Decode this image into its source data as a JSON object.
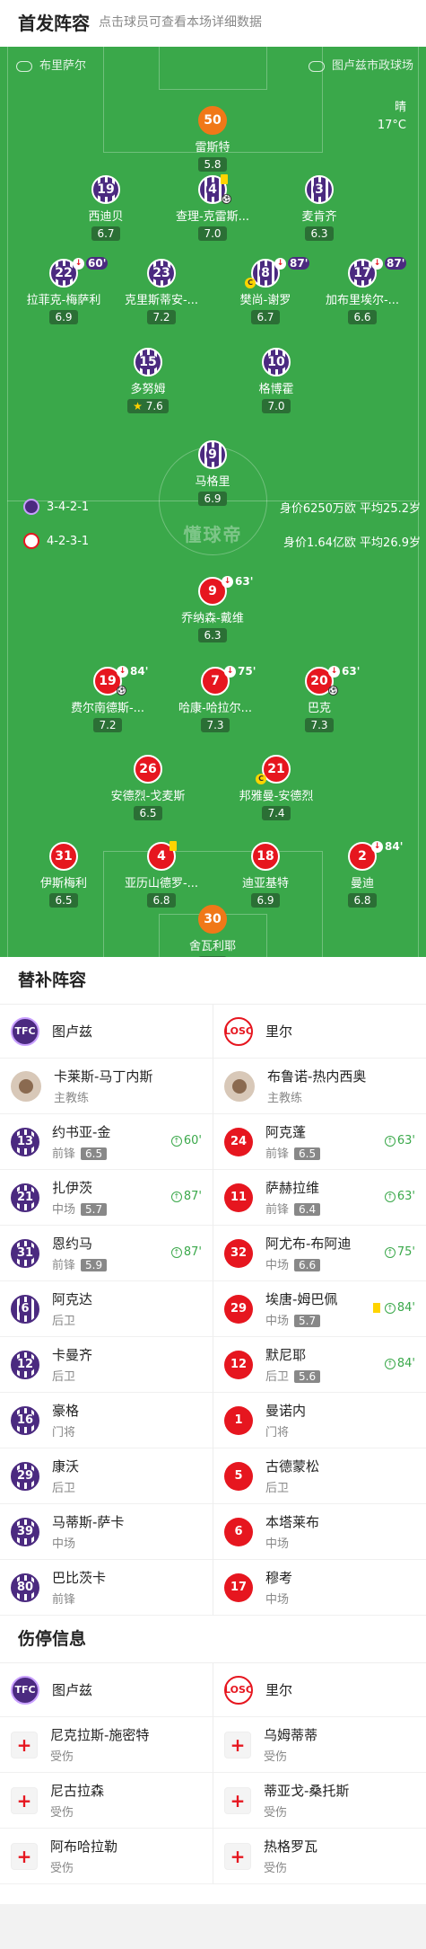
{
  "header": {
    "title": "首发阵容",
    "hint": "点击球员可查看本场详细数据"
  },
  "pitch": {
    "home_team": "布里萨尔",
    "away_team": "图卢兹市政球场",
    "weather": "晴",
    "temperature": "17°C",
    "center_watermark": "懂球帝",
    "tou_formation": "3-4-2-1",
    "tou_value": "身价6250万欧  平均25.2岁",
    "lil_formation": "4-2-3-1",
    "lil_value": "身价1.64亿欧  平均26.9岁"
  },
  "tou_players": [
    {
      "num": "50",
      "name": "雷斯特",
      "rating": "5.8",
      "gk": true
    },
    {
      "num": "19",
      "name": "西迪贝",
      "rating": "6.7"
    },
    {
      "num": "4",
      "name": "查理-克雷斯...",
      "rating": "7.0",
      "yellow": true,
      "goal": true
    },
    {
      "num": "3",
      "name": "麦肯齐",
      "rating": "6.3"
    },
    {
      "num": "22",
      "name": "拉菲克-梅萨利",
      "rating": "6.9",
      "sub": "60'"
    },
    {
      "num": "23",
      "name": "克里斯蒂安-...",
      "rating": "7.2"
    },
    {
      "num": "8",
      "name": "樊尚-谢罗",
      "rating": "6.7",
      "sub": "87'",
      "cap": true
    },
    {
      "num": "17",
      "name": "加布里埃尔-...",
      "rating": "6.6",
      "sub": "87'"
    },
    {
      "num": "15",
      "name": "多努姆",
      "rating": "7.6",
      "star": true
    },
    {
      "num": "10",
      "name": "格博霍",
      "rating": "7.0"
    },
    {
      "num": "9",
      "name": "马格里",
      "rating": "6.9"
    }
  ],
  "lil_players": [
    {
      "num": "9",
      "name": "乔纳森-戴维",
      "rating": "6.3",
      "sub": "63'"
    },
    {
      "num": "19",
      "name": "费尔南德斯-...",
      "rating": "7.2",
      "sub": "84'",
      "goal": true
    },
    {
      "num": "7",
      "name": "哈康-哈拉尔...",
      "rating": "7.3",
      "sub": "75'"
    },
    {
      "num": "20",
      "name": "巴克",
      "rating": "7.3",
      "sub": "63'",
      "goal": true
    },
    {
      "num": "26",
      "name": "安德烈-戈麦斯",
      "rating": "6.5"
    },
    {
      "num": "21",
      "name": "邦雅曼-安德烈",
      "rating": "7.4",
      "cap": true
    },
    {
      "num": "31",
      "name": "伊斯梅利",
      "rating": "6.5"
    },
    {
      "num": "4",
      "name": "亚历山德罗-...",
      "rating": "6.8",
      "yellow": true
    },
    {
      "num": "18",
      "name": "迪亚基特",
      "rating": "6.9"
    },
    {
      "num": "2",
      "name": "曼迪",
      "rating": "6.8",
      "sub": "84'"
    },
    {
      "num": "30",
      "name": "舍瓦利耶",
      "rating": "7.3",
      "gk": true
    }
  ],
  "subs": {
    "title": "替补阵容",
    "tou": {
      "team": "图卢兹",
      "coach": "卡莱斯-马丁内斯",
      "coach_role": "主教练",
      "players": [
        {
          "num": "13",
          "name": "约书亚-金",
          "pos": "前锋",
          "rating": "6.5",
          "in": "60'"
        },
        {
          "num": "21",
          "name": "扎伊茨",
          "pos": "中场",
          "rating": "5.7",
          "in": "87'"
        },
        {
          "num": "31",
          "name": "恩约马",
          "pos": "前锋",
          "rating": "5.9",
          "in": "87'"
        },
        {
          "num": "6",
          "name": "阿克达",
          "pos": "后卫"
        },
        {
          "num": "12",
          "name": "卡曼齐",
          "pos": "后卫"
        },
        {
          "num": "16",
          "name": "豪格",
          "pos": "门将"
        },
        {
          "num": "29",
          "name": "康沃",
          "pos": "后卫"
        },
        {
          "num": "39",
          "name": "马蒂斯-萨卡",
          "pos": "中场"
        },
        {
          "num": "80",
          "name": "巴比茨卡",
          "pos": "前锋"
        }
      ]
    },
    "lil": {
      "team": "里尔",
      "coach": "布鲁诺-热内西奥",
      "coach_role": "主教练",
      "players": [
        {
          "num": "24",
          "name": "阿克蓬",
          "pos": "前锋",
          "rating": "6.5",
          "in": "63'"
        },
        {
          "num": "11",
          "name": "萨赫拉维",
          "pos": "前锋",
          "rating": "6.4",
          "in": "63'"
        },
        {
          "num": "32",
          "name": "阿尤布-布阿迪",
          "pos": "中场",
          "rating": "6.6",
          "in": "75'"
        },
        {
          "num": "29",
          "name": "埃唐-姆巴佩",
          "pos": "中场",
          "rating": "5.7",
          "in": "84'",
          "yellow": true
        },
        {
          "num": "12",
          "name": "默尼耶",
          "pos": "后卫",
          "rating": "5.6",
          "in": "84'"
        },
        {
          "num": "1",
          "name": "曼诺内",
          "pos": "门将"
        },
        {
          "num": "5",
          "name": "古德蒙松",
          "pos": "后卫"
        },
        {
          "num": "6",
          "name": "本塔莱布",
          "pos": "中场"
        },
        {
          "num": "17",
          "name": "穆考",
          "pos": "中场"
        }
      ]
    }
  },
  "injuries": {
    "title": "伤停信息",
    "tou": {
      "team": "图卢兹",
      "players": [
        {
          "name": "尼克拉斯-施密特",
          "status": "受伤"
        },
        {
          "name": "尼古拉森",
          "status": "受伤"
        },
        {
          "name": "阿布哈拉勒",
          "status": "受伤"
        }
      ]
    },
    "lil": {
      "team": "里尔",
      "players": [
        {
          "name": "乌姆蒂蒂",
          "status": "受伤"
        },
        {
          "name": "蒂亚戈-桑托斯",
          "status": "受伤"
        },
        {
          "name": "热格罗瓦",
          "status": "受伤"
        }
      ]
    }
  },
  "colors": {
    "pitch": "#3aa84a",
    "toulouse": "#4b2a80",
    "lille": "#e6161f",
    "sub_in": "#3aa84a"
  }
}
